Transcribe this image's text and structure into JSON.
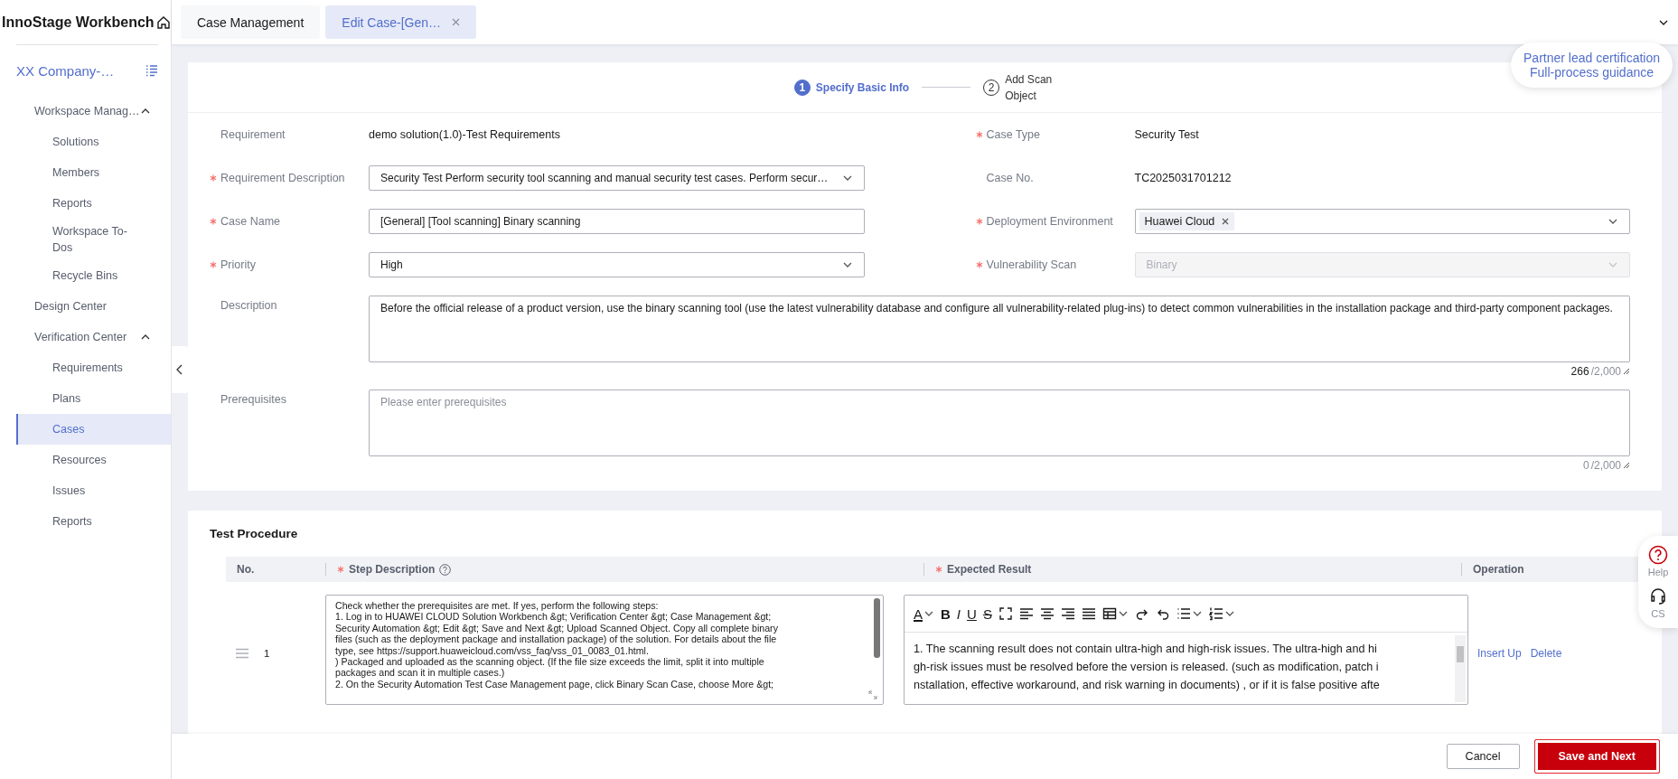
{
  "sidebar": {
    "title": "InnoStage Workbench",
    "workspace": "XX Company-…",
    "items": [
      {
        "label": "Workspace Manag…",
        "expanded": true,
        "selected": false,
        "children": [
          {
            "label": "Solutions",
            "selected": false
          },
          {
            "label": "Members",
            "selected": false
          },
          {
            "label": "Reports",
            "selected": false
          },
          {
            "label": "Workspace To-Dos",
            "selected": false
          },
          {
            "label": "Recycle Bins",
            "selected": false
          }
        ]
      },
      {
        "label": "Design Center",
        "selected": false
      },
      {
        "label": "Verification Center",
        "expanded": true,
        "selected": false,
        "children": [
          {
            "label": "Requirements",
            "selected": false
          },
          {
            "label": "Plans",
            "selected": false
          },
          {
            "label": "Cases",
            "selected": true
          },
          {
            "label": "Resources",
            "selected": false
          },
          {
            "label": "Issues",
            "selected": false
          },
          {
            "label": "Reports",
            "selected": false
          }
        ]
      }
    ]
  },
  "tabs": [
    {
      "label": "Case Management",
      "selected": false,
      "closable": false
    },
    {
      "label": "Edit Case-[Gen…",
      "selected": true,
      "closable": true
    }
  ],
  "guidance": {
    "lines": [
      "Partner lead certification",
      "Full-process guidance"
    ]
  },
  "steps": [
    {
      "number": "1",
      "label": "Specify Basic Info",
      "selected": true
    },
    {
      "number": "2",
      "label": "Add Scan Object",
      "selected": false
    }
  ],
  "form": {
    "fields": [
      {
        "label": "Requirement",
        "required": false,
        "kind": "text",
        "value": "demo solution(1.0)-Test Requirements"
      },
      {
        "label": "Case Type",
        "required": true,
        "kind": "text",
        "value": "Security Test"
      },
      {
        "label": "Requirement Description",
        "required": true,
        "kind": "select",
        "value": "Security Test Perform security tool scanning and manual security test cases. Perform secur…",
        "disabled": false
      },
      {
        "label": "Case No.",
        "required": false,
        "kind": "text",
        "value": "TC2025031701212"
      },
      {
        "label": "Case Name",
        "required": true,
        "kind": "input",
        "value": "[General] [Tool scanning] Binary scanning"
      },
      {
        "label": "Deployment Environment",
        "required": true,
        "kind": "tags",
        "tags": [
          "Huawei Cloud"
        ]
      },
      {
        "label": "Priority",
        "required": true,
        "kind": "select",
        "value": "High",
        "disabled": false
      },
      {
        "label": "Vulnerability Scan",
        "required": true,
        "kind": "select",
        "value": "Binary",
        "disabled": true
      }
    ],
    "text_areas": [
      {
        "label": "Description",
        "value": "Before the official release of a product version, use the binary scanning tool (use the latest vulnerability database and configure all vulnerability-related plug-ins) to detect common vulnerabilities in the installation package and third-party component packages.",
        "count": "266",
        "max": "/2,000"
      },
      {
        "label": "Prerequisites",
        "placeholder": "Please enter prerequisites",
        "count": "0",
        "max": "/2,000"
      }
    ]
  },
  "procedure": {
    "title": "Test Procedure",
    "columns": [
      {
        "label": "No.",
        "required": false,
        "help": false
      },
      {
        "label": "Step Description",
        "required": true,
        "help": true
      },
      {
        "label": "Expected Result",
        "required": true,
        "help": false
      },
      {
        "label": "Operation",
        "required": false,
        "help": false
      }
    ],
    "toolbar": [
      {
        "kind": "font-color",
        "glyph": "A"
      },
      {
        "kind": "bold",
        "glyph": "B"
      },
      {
        "kind": "italic",
        "glyph": "I"
      },
      {
        "kind": "underline",
        "glyph": "U"
      },
      {
        "kind": "strike",
        "glyph": "S"
      },
      {
        "kind": "fullscreen"
      },
      {
        "kind": "align-left"
      },
      {
        "kind": "align-center"
      },
      {
        "kind": "align-right"
      },
      {
        "kind": "justify"
      },
      {
        "kind": "table"
      },
      {
        "kind": "redo"
      },
      {
        "kind": "undo"
      },
      {
        "kind": "bullets"
      },
      {
        "kind": "numbering"
      }
    ],
    "rows": [
      {
        "no": "1",
        "step_description": [
          "Check whether the prerequisites are met. If yes, perform the following steps:",
          "1. Log in to HUAWEI CLOUD Solution Workbench &gt; Verification Center &gt; Case Management &gt;",
          "Security Automation &gt; Edit &gt; Save and Next &gt; Upload Scanned Object. Copy all complete binary",
          "files (such as the deployment package and installation package) of the solution. For details about the file",
          "type, see https://support.huaweicloud.com/vss_faq/vss_01_0083_01.html.",
          ") Packaged and uploaded as the scanning object. (If the file size exceeds the limit, split it into multiple",
          "packages and scan it in multiple cases.)",
          "2. On the Security Automation Test Case Management page, click Binary Scan Case, choose More &gt;"
        ],
        "expected_result": [
          "1. The scanning result does not contain ultra-high and high-risk issues. The ultra-high and hi",
          "gh-risk issues must be resolved before the version is released. (such as modification, patch i",
          "nstallation, effective workaround, and risk warning in documents) , or if it is false positive afte"
        ],
        "actions": [
          "Insert Up",
          "Delete"
        ]
      }
    ]
  },
  "float_help": [
    {
      "kind": "help",
      "label": "Help"
    },
    {
      "kind": "cs",
      "label": "CS"
    }
  ],
  "footer": {
    "buttons": [
      {
        "kind": "secondary",
        "label": "Cancel"
      },
      {
        "kind": "primary",
        "label": "Save and Next"
      }
    ]
  }
}
